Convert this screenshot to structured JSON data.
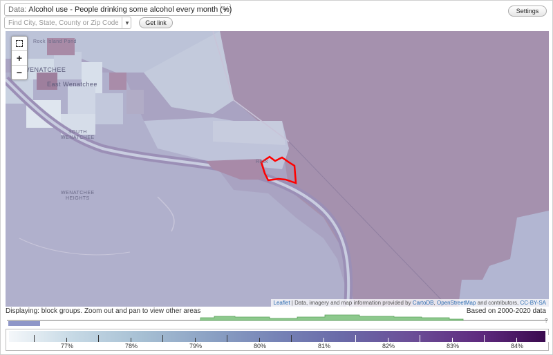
{
  "header": {
    "data_prefix": "Data:",
    "data_value": "Alcohol use - People drinking some alcohol every month (%)",
    "search_placeholder": "Find City, State, County or Zip Code",
    "get_link_label": "Get link",
    "settings_label": "Settings"
  },
  "map": {
    "labels": {
      "wenatchee": "WENATCHEE",
      "east_wenatchee": "East Wenatchee",
      "south_wenatchee_1": "SOUTH",
      "south_wenatchee_2": "WENATCHEE",
      "heights_1": "WENATCHEE",
      "heights_2": "HEIGHTS",
      "road": "Rock Island Pond",
      "rock_island": "Rock"
    },
    "zoom": {
      "fullscreen": "fullscreen-icon",
      "plus": "+",
      "minus": "−"
    },
    "colors": {
      "highlight": "#ff0000",
      "base": "#a7a2c0"
    },
    "attribution": {
      "leaflet": "Leaflet",
      "text1": " | Data, imagery and map information provided by ",
      "cartodb": "CartoDB",
      "text2": ", ",
      "osm": "OpenStreetMap",
      "text3": " and contributors, ",
      "license": "CC-BY-SA"
    }
  },
  "footer": {
    "displaying": "Displaying: block groups. Zoom out and pan to view other areas",
    "based_on": "Based on 2000-2020 data",
    "legend_ticks": [
      "77%",
      "78%",
      "79%",
      "80%",
      "81%",
      "82%",
      "83%",
      "84%"
    ]
  }
}
